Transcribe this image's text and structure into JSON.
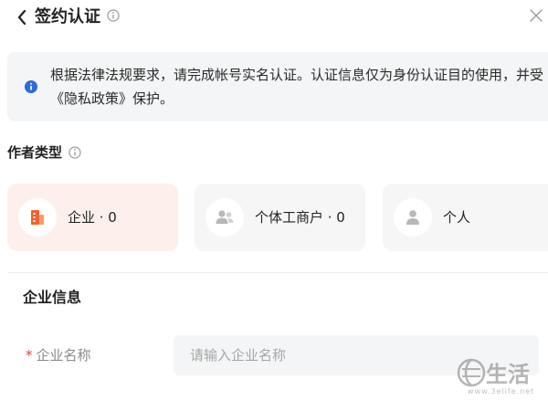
{
  "header": {
    "title": "签约认证"
  },
  "notice": {
    "text": "根据法律法规要求，请完成帐号实名认证。认证信息仅为身份认证目的使用，并受《隐私政策》保护。"
  },
  "author_type": {
    "label": "作者类型",
    "options": [
      {
        "label": "企业 · 0",
        "icon": "building-icon",
        "selected": true
      },
      {
        "label": "个体工商户 · 0",
        "icon": "users-icon",
        "selected": false
      },
      {
        "label": "个人",
        "icon": "user-icon",
        "selected": false
      }
    ]
  },
  "form": {
    "title": "企业信息",
    "fields": [
      {
        "required_mark": "*",
        "label": "企业名称",
        "placeholder": "请输入企业名称",
        "value": ""
      }
    ]
  },
  "colors": {
    "accent": "#f0632a",
    "info": "#2d6bd6",
    "selected_bg": "#fdf0ec",
    "required": "#e5403a"
  },
  "watermark": {
    "text": "生活",
    "url": "www.3elife.net"
  }
}
